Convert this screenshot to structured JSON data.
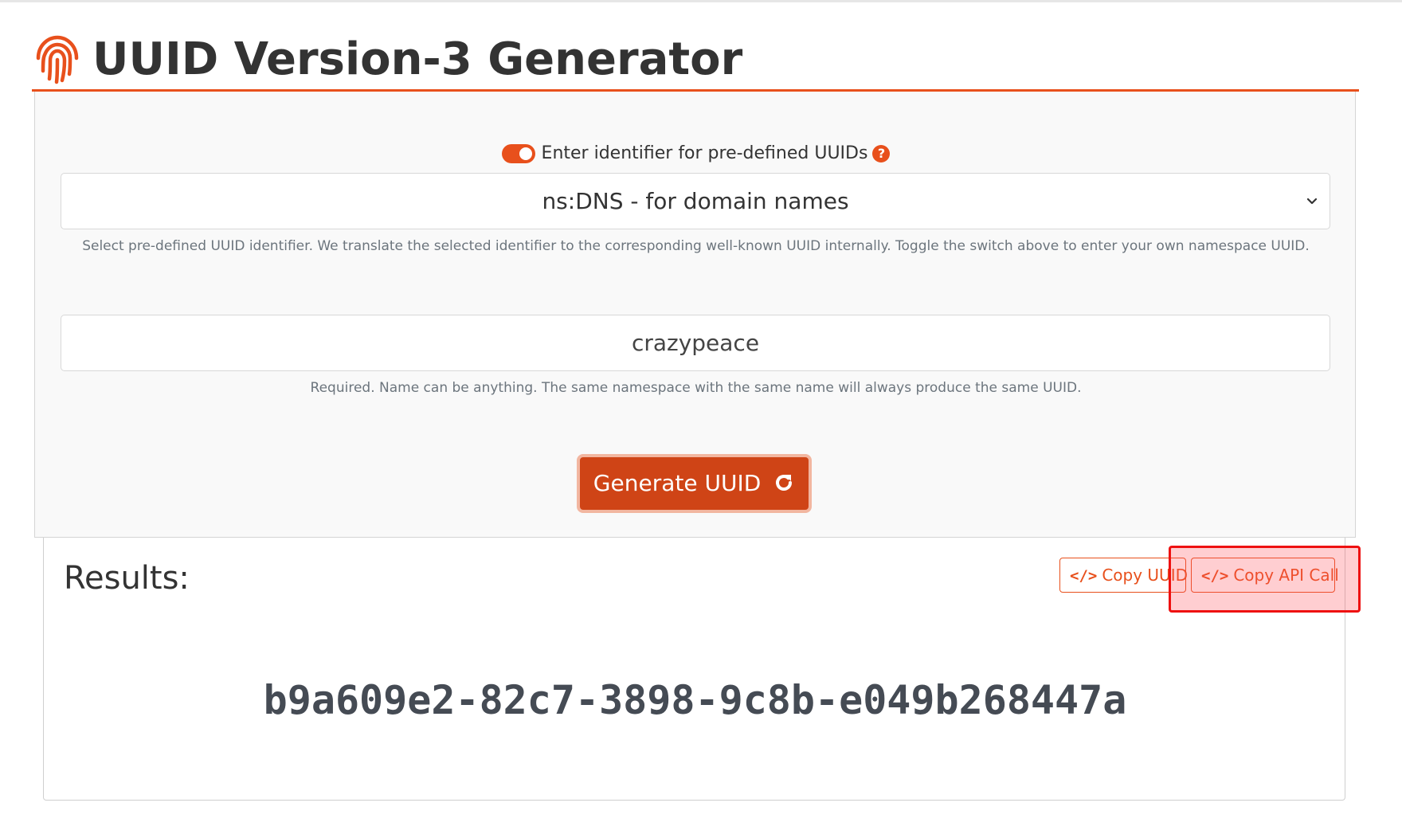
{
  "header": {
    "title": "UUID Version-3 Generator",
    "logo_icon": "fingerprint-icon",
    "accent_color": "#e8501c"
  },
  "form": {
    "toggle": {
      "label": "Enter identifier for pre-defined UUIDs",
      "state": "on",
      "help_icon": "question-circle-icon",
      "help_glyph": "?"
    },
    "namespace_select": {
      "selected": "ns:DNS - for domain names",
      "help": "Select pre-defined UUID identifier. We translate the selected identifier to the corresponding well-known UUID internally. Toggle the switch above to enter your own namespace UUID."
    },
    "name_input": {
      "value": "crazypeace",
      "help": "Required. Name can be anything. The same namespace with the same name will always produce the same UUID."
    },
    "generate_button": {
      "label": "Generate UUID",
      "icon": "refresh-icon"
    }
  },
  "results": {
    "title": "Results:",
    "copy_uuid_label": "Copy UUID",
    "copy_api_label": "Copy API Call",
    "code_icon_glyph": "</>",
    "uuid": "b9a609e2-82c7-3898-9c8b-e049b268447a"
  },
  "highlight": {
    "target": "copy-api-call-button",
    "color": "#ee1111"
  }
}
